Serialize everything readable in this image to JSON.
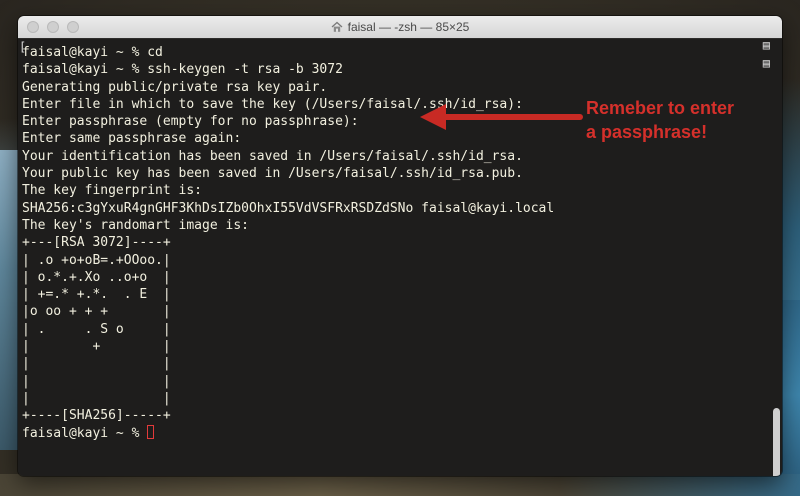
{
  "window": {
    "title": "faisal — -zsh — 85×25"
  },
  "terminal": {
    "lines": [
      "faisal@kayi ~ % cd",
      "faisal@kayi ~ % ssh-keygen -t rsa -b 3072",
      "Generating public/private rsa key pair.",
      "Enter file in which to save the key (/Users/faisal/.ssh/id_rsa):",
      "Enter passphrase (empty for no passphrase):",
      "Enter same passphrase again:",
      "Your identification has been saved in /Users/faisal/.ssh/id_rsa.",
      "Your public key has been saved in /Users/faisal/.ssh/id_rsa.pub.",
      "The key fingerprint is:",
      "SHA256:c3gYxuR4gnGHF3KhDsIZb0OhxI55VdVSFRxRSDZdSNo faisal@kayi.local",
      "The key's randomart image is:",
      "+---[RSA 3072]----+",
      "| .o +o+oB=.+OOoo.|",
      "| o.*.+.Xo ..o+o  |",
      "| +=.* +.*.  . E  |",
      "|o oo + + +       |",
      "| .     . S o     |",
      "|        +        |",
      "|                 |",
      "|                 |",
      "|                 |",
      "+----[SHA256]-----+",
      "faisal@kayi ~ % "
    ]
  },
  "annotation": {
    "text_line1": "Remeber to enter",
    "text_line2": "a passphrase!",
    "color": "#d5302b"
  },
  "icons": {
    "title_icon": "home-icon",
    "cursor": "cursor-block"
  }
}
